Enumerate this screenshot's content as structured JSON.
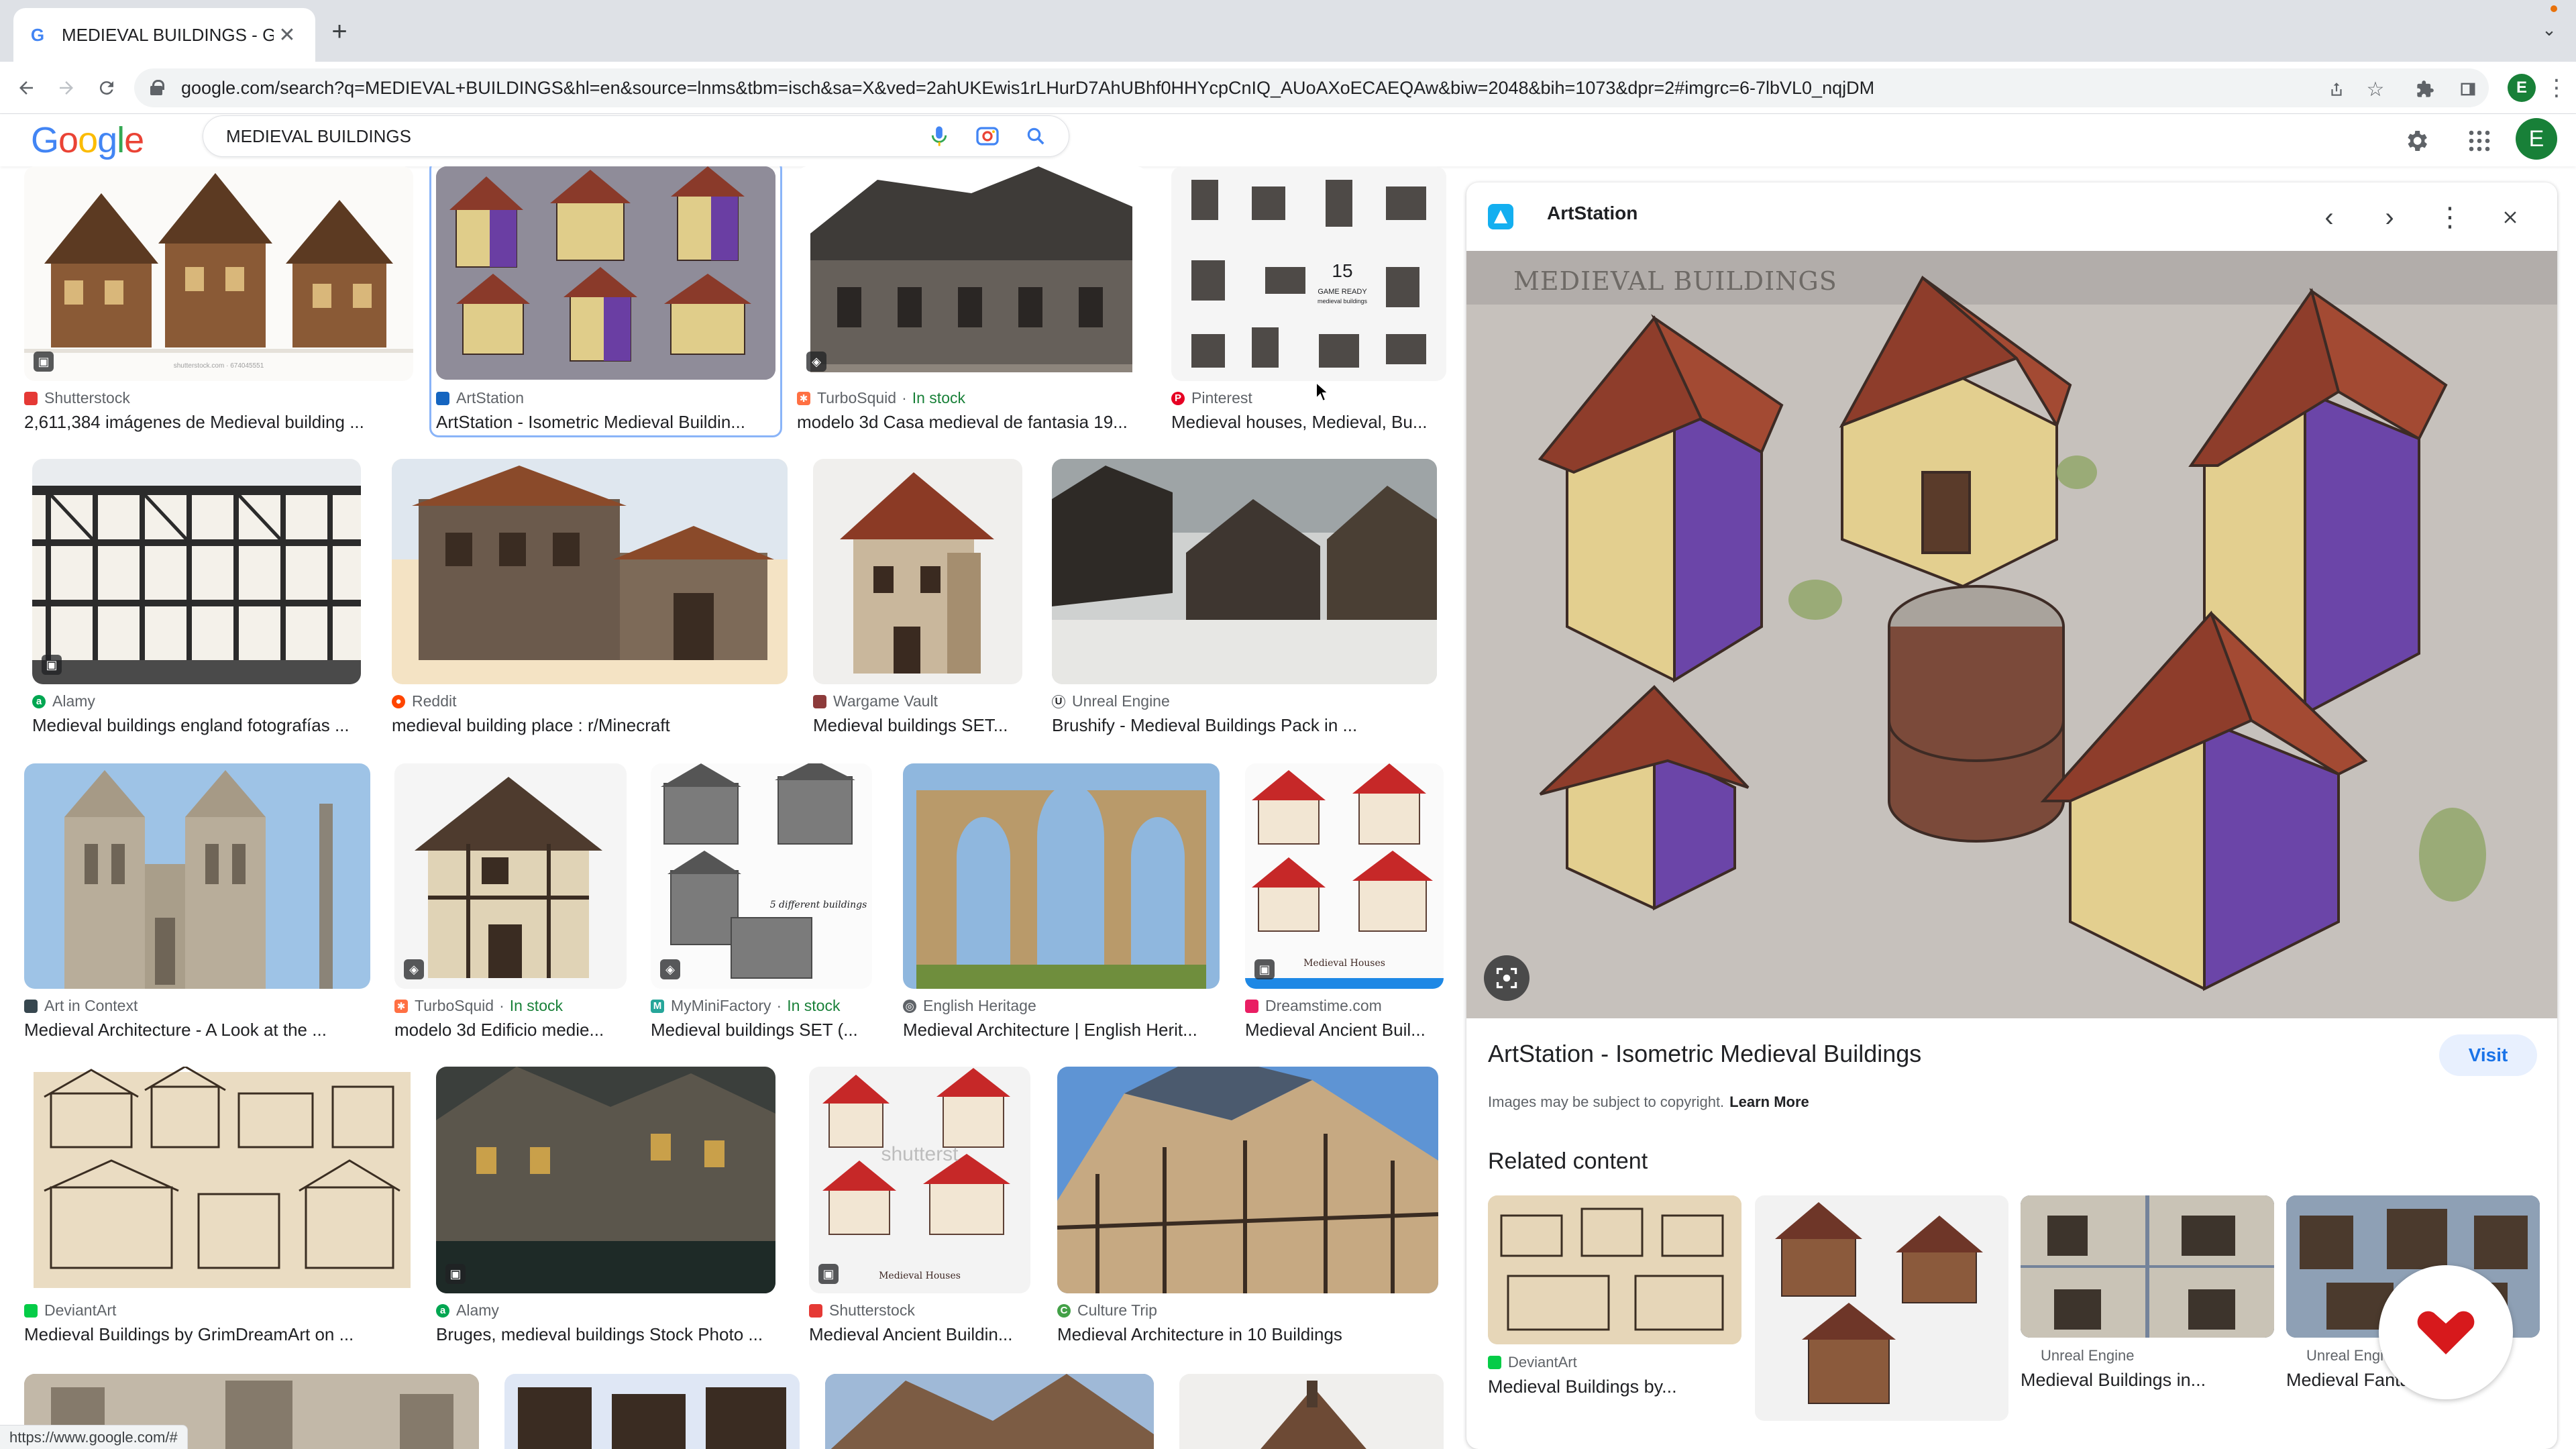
{
  "browser": {
    "tab_title": "MEDIEVAL BUILDINGS - Google",
    "url": "google.com/search?q=MEDIEVAL+BUILDINGS&hl=en&source=lnms&tbm=isch&sa=X&ved=2ahUKEwis1rLHurD7AhUBhf0HHYcpCnIQ_AUoAXoECAEQAw&biw=2048&bih=1073&dpr=2#imgrc=6-7lbVL0_nqjDM",
    "profile_initial": "E",
    "status_url": "https://www.google.com/#"
  },
  "google": {
    "logo_letters": [
      "G",
      "o",
      "o",
      "g",
      "l",
      "e"
    ],
    "logo_colors": [
      "#4285F4",
      "#EA4335",
      "#FBBC05",
      "#4285F4",
      "#34A853",
      "#EA4335"
    ],
    "query": "MEDIEVAL BUILDINGS",
    "avatar_initial": "E"
  },
  "results": [
    {
      "source": "Shutterstock",
      "caption": "2,611,384 imágenes de Medieval building ...",
      "icon_color": "#e53935",
      "badge": true
    },
    {
      "source": "ArtStation",
      "caption": "ArtStation - Isometric Medieval Buildin...",
      "icon_color": "#1565c0",
      "selected": true
    },
    {
      "source": "TurboSquid",
      "stock": "In stock",
      "caption": "modelo 3d Casa medieval de fantasia 19...",
      "icon_color": "#ff7043",
      "badge": true
    },
    {
      "source": "Pinterest",
      "caption": "Medieval houses, Medieval, Bu...",
      "icon_color": "#e60023"
    },
    {
      "source": "Alamy",
      "caption": "Medieval buildings england fotografías ...",
      "icon_color": "#00a651",
      "badge": true
    },
    {
      "source": "Reddit",
      "caption": "medieval building place : r/Minecraft",
      "icon_color": "#ff4500"
    },
    {
      "source": "Wargame Vault",
      "caption": "Medieval buildings SET...",
      "icon_color": "#8d3b3b"
    },
    {
      "source": "Unreal Engine",
      "caption": "Brushify - Medieval Buildings Pack in ...",
      "icon_color": "#ffffff"
    },
    {
      "source": "Art in Context",
      "caption": "Medieval Architecture - A Look at the ...",
      "icon_color": "#37474f"
    },
    {
      "source": "TurboSquid",
      "stock": "In stock",
      "caption": "modelo 3d Edificio medie...",
      "icon_color": "#ff7043",
      "badge": true
    },
    {
      "source": "MyMiniFactory",
      "stock": "In stock",
      "caption": "Medieval buildings SET (...",
      "icon_color": "#26a69a",
      "badge": true
    },
    {
      "source": "English Heritage",
      "caption": "Medieval Architecture | English Herit...",
      "icon_color": "#5f6368"
    },
    {
      "source": "Dreamstime.com",
      "caption": "Medieval Ancient Buil...",
      "icon_color": "#e91e63",
      "badge": true
    },
    {
      "source": "DeviantArt",
      "caption": "Medieval Buildings by GrimDreamArt on ...",
      "icon_color": "#05cc47"
    },
    {
      "source": "Alamy",
      "caption": "Bruges, medieval buildings Stock Photo ...",
      "icon_color": "#00a651",
      "badge": true
    },
    {
      "source": "Shutterstock",
      "caption": "Medieval Ancient Buildin...",
      "icon_color": "#e53935",
      "badge": true
    },
    {
      "source": "Culture Trip",
      "caption": "Medieval Architecture in 10 Buildings",
      "icon_color": "#43a047"
    }
  ],
  "thumb_text": {
    "shutterstock_wm": "shutterstock.com · 674045551",
    "game_ready_num": "15",
    "game_ready_txt": "GAME READY",
    "game_ready_sub": "medieval buildings",
    "medieval_houses": "Medieval Houses",
    "shutter_wm": "shutterst",
    "five_diff": "5 different buildings"
  },
  "panel": {
    "site": "ArtStation",
    "image_heading": "MEDIEVAL BUILDINGS",
    "title": "ArtStation - Isometric Medieval Buildings",
    "visit": "Visit",
    "copyright": "Images may be subject to copyright.",
    "learn_more": "Learn More",
    "related_heading": "Related content",
    "related": [
      {
        "source": "DeviantArt",
        "caption": "Medieval Buildings by...",
        "icon_color": "#05cc47"
      },
      {
        "source": "",
        "caption": ""
      },
      {
        "source": "Unreal Engine",
        "caption": "Medieval Buildings in..."
      },
      {
        "source": "Unreal Engi",
        "caption": "Medieval Fanta... gs ..."
      }
    ]
  }
}
